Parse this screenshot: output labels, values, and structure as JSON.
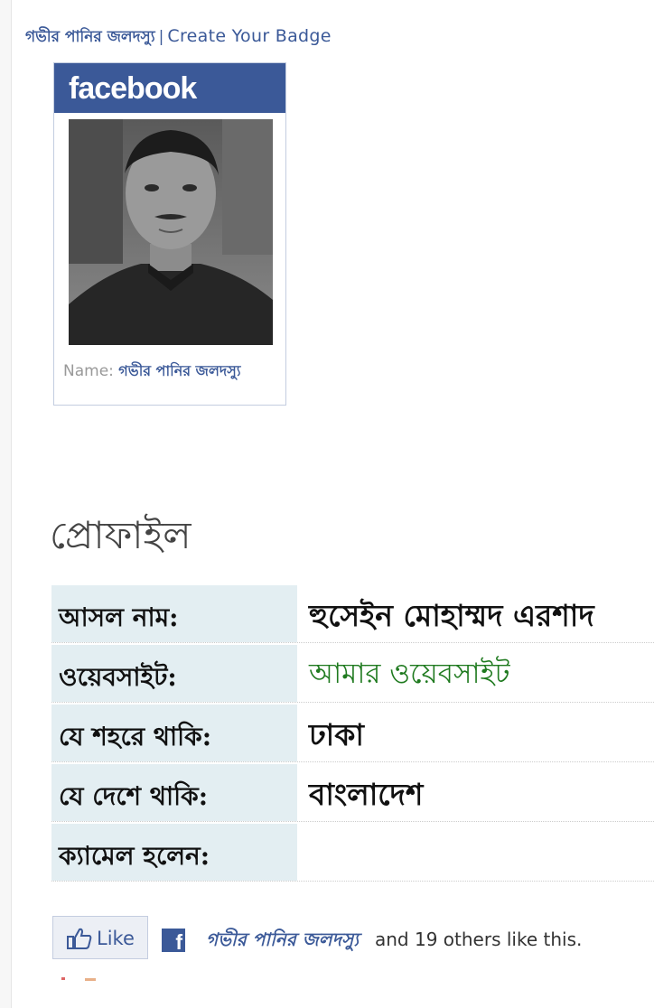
{
  "top": {
    "name": "গভীর পানির জলদস্যু",
    "separator": "|",
    "create_badge": "Create Your Badge"
  },
  "badge": {
    "logo": "facebook",
    "photo_icon": "profile-photo",
    "name_label": "Name:",
    "name_value": "গভীর পানির জলদস্যু"
  },
  "profile": {
    "title": "প্রোফাইল",
    "rows": [
      {
        "label": "আসল নাম:",
        "value": "হুসেইন মোহাম্মদ এরশাদ"
      },
      {
        "label": "ওয়েবসাইট:",
        "value": "আমার ওয়েবসাইট"
      },
      {
        "label": "যে শহরে থাকি:",
        "value": "ঢাকা"
      },
      {
        "label": "যে দেশে থাকি:",
        "value": "বাংলাদেশ"
      },
      {
        "label": "ক্যামেল হলেন:",
        "value": ""
      }
    ]
  },
  "like": {
    "button_label": "Like",
    "fb_icon": "f",
    "liker_name": "গভীর পানির জলদস্যু",
    "others_text": "and 19 others like this."
  },
  "colors": {
    "facebook_blue": "#3b5998",
    "label_bg": "#e3eef2",
    "link_green": "#1f7a1f"
  }
}
